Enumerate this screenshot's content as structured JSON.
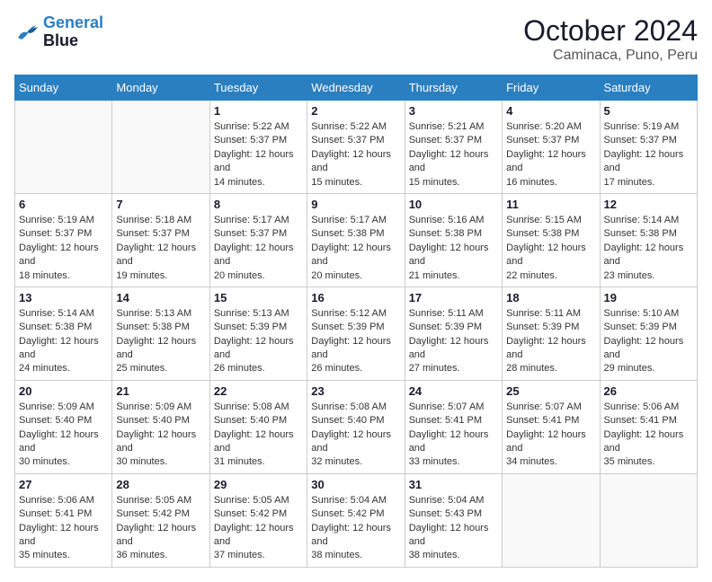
{
  "header": {
    "logo_line1": "General",
    "logo_line2": "Blue",
    "month": "October 2024",
    "location": "Caminaca, Puno, Peru"
  },
  "weekdays": [
    "Sunday",
    "Monday",
    "Tuesday",
    "Wednesday",
    "Thursday",
    "Friday",
    "Saturday"
  ],
  "rows": [
    [
      {
        "day": "",
        "info": ""
      },
      {
        "day": "",
        "info": ""
      },
      {
        "day": "1",
        "info": "Sunrise: 5:22 AM\nSunset: 5:37 PM\nDaylight: 12 hours and 14 minutes."
      },
      {
        "day": "2",
        "info": "Sunrise: 5:22 AM\nSunset: 5:37 PM\nDaylight: 12 hours and 15 minutes."
      },
      {
        "day": "3",
        "info": "Sunrise: 5:21 AM\nSunset: 5:37 PM\nDaylight: 12 hours and 15 minutes."
      },
      {
        "day": "4",
        "info": "Sunrise: 5:20 AM\nSunset: 5:37 PM\nDaylight: 12 hours and 16 minutes."
      },
      {
        "day": "5",
        "info": "Sunrise: 5:19 AM\nSunset: 5:37 PM\nDaylight: 12 hours and 17 minutes."
      }
    ],
    [
      {
        "day": "6",
        "info": "Sunrise: 5:19 AM\nSunset: 5:37 PM\nDaylight: 12 hours and 18 minutes."
      },
      {
        "day": "7",
        "info": "Sunrise: 5:18 AM\nSunset: 5:37 PM\nDaylight: 12 hours and 19 minutes."
      },
      {
        "day": "8",
        "info": "Sunrise: 5:17 AM\nSunset: 5:37 PM\nDaylight: 12 hours and 20 minutes."
      },
      {
        "day": "9",
        "info": "Sunrise: 5:17 AM\nSunset: 5:38 PM\nDaylight: 12 hours and 20 minutes."
      },
      {
        "day": "10",
        "info": "Sunrise: 5:16 AM\nSunset: 5:38 PM\nDaylight: 12 hours and 21 minutes."
      },
      {
        "day": "11",
        "info": "Sunrise: 5:15 AM\nSunset: 5:38 PM\nDaylight: 12 hours and 22 minutes."
      },
      {
        "day": "12",
        "info": "Sunrise: 5:14 AM\nSunset: 5:38 PM\nDaylight: 12 hours and 23 minutes."
      }
    ],
    [
      {
        "day": "13",
        "info": "Sunrise: 5:14 AM\nSunset: 5:38 PM\nDaylight: 12 hours and 24 minutes."
      },
      {
        "day": "14",
        "info": "Sunrise: 5:13 AM\nSunset: 5:38 PM\nDaylight: 12 hours and 25 minutes."
      },
      {
        "day": "15",
        "info": "Sunrise: 5:13 AM\nSunset: 5:39 PM\nDaylight: 12 hours and 26 minutes."
      },
      {
        "day": "16",
        "info": "Sunrise: 5:12 AM\nSunset: 5:39 PM\nDaylight: 12 hours and 26 minutes."
      },
      {
        "day": "17",
        "info": "Sunrise: 5:11 AM\nSunset: 5:39 PM\nDaylight: 12 hours and 27 minutes."
      },
      {
        "day": "18",
        "info": "Sunrise: 5:11 AM\nSunset: 5:39 PM\nDaylight: 12 hours and 28 minutes."
      },
      {
        "day": "19",
        "info": "Sunrise: 5:10 AM\nSunset: 5:39 PM\nDaylight: 12 hours and 29 minutes."
      }
    ],
    [
      {
        "day": "20",
        "info": "Sunrise: 5:09 AM\nSunset: 5:40 PM\nDaylight: 12 hours and 30 minutes."
      },
      {
        "day": "21",
        "info": "Sunrise: 5:09 AM\nSunset: 5:40 PM\nDaylight: 12 hours and 30 minutes."
      },
      {
        "day": "22",
        "info": "Sunrise: 5:08 AM\nSunset: 5:40 PM\nDaylight: 12 hours and 31 minutes."
      },
      {
        "day": "23",
        "info": "Sunrise: 5:08 AM\nSunset: 5:40 PM\nDaylight: 12 hours and 32 minutes."
      },
      {
        "day": "24",
        "info": "Sunrise: 5:07 AM\nSunset: 5:41 PM\nDaylight: 12 hours and 33 minutes."
      },
      {
        "day": "25",
        "info": "Sunrise: 5:07 AM\nSunset: 5:41 PM\nDaylight: 12 hours and 34 minutes."
      },
      {
        "day": "26",
        "info": "Sunrise: 5:06 AM\nSunset: 5:41 PM\nDaylight: 12 hours and 35 minutes."
      }
    ],
    [
      {
        "day": "27",
        "info": "Sunrise: 5:06 AM\nSunset: 5:41 PM\nDaylight: 12 hours and 35 minutes."
      },
      {
        "day": "28",
        "info": "Sunrise: 5:05 AM\nSunset: 5:42 PM\nDaylight: 12 hours and 36 minutes."
      },
      {
        "day": "29",
        "info": "Sunrise: 5:05 AM\nSunset: 5:42 PM\nDaylight: 12 hours and 37 minutes."
      },
      {
        "day": "30",
        "info": "Sunrise: 5:04 AM\nSunset: 5:42 PM\nDaylight: 12 hours and 38 minutes."
      },
      {
        "day": "31",
        "info": "Sunrise: 5:04 AM\nSunset: 5:43 PM\nDaylight: 12 hours and 38 minutes."
      },
      {
        "day": "",
        "info": ""
      },
      {
        "day": "",
        "info": ""
      }
    ]
  ]
}
